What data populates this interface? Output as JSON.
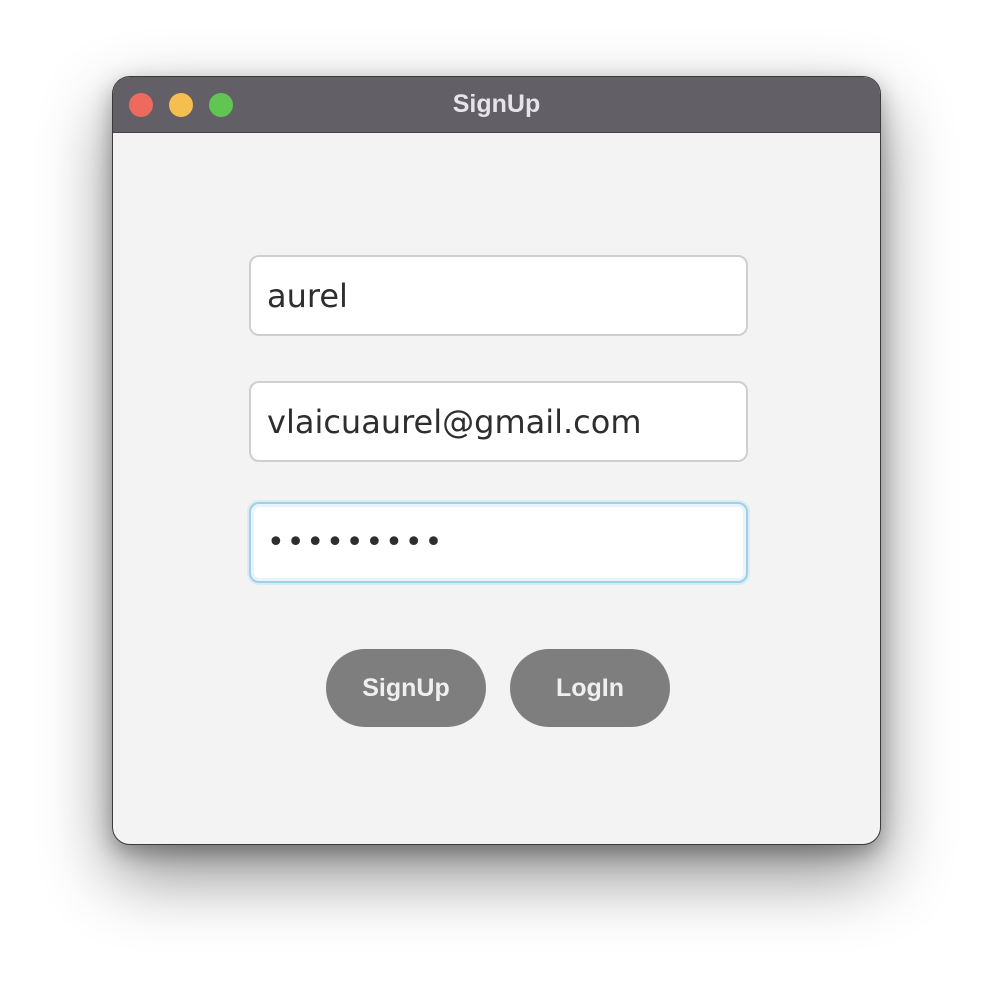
{
  "window": {
    "title": "SignUp",
    "controls": {
      "close": "close-button",
      "minimize": "minimize-button",
      "maximize": "maximize-button"
    }
  },
  "form": {
    "username": {
      "value": "aurel"
    },
    "email": {
      "value": "vlaicuaurel@gmail.com"
    },
    "password": {
      "value": "aaaaaaaaa",
      "focused": true
    },
    "signup_label": "SignUp",
    "login_label": "LogIn"
  },
  "colors": {
    "titlebar": "#625f66",
    "button": "#7e7e7e",
    "focus_ring": "#9fd0e4",
    "close": "#ec6a5e",
    "minimize": "#f4bf4f",
    "maximize": "#61c554"
  }
}
